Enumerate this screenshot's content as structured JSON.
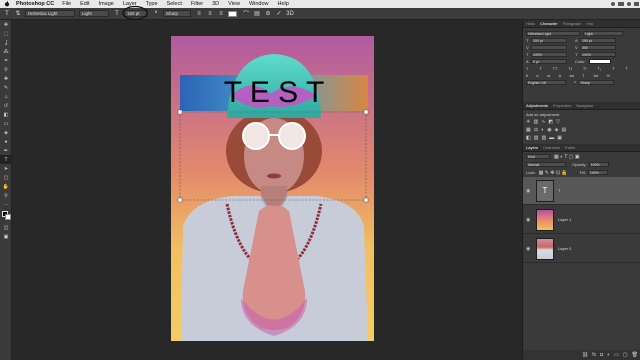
{
  "menubar": {
    "app_name": "Photoshop CC",
    "items": [
      "File",
      "Edit",
      "Image",
      "Layer",
      "Type",
      "Select",
      "Filter",
      "3D",
      "View",
      "Window",
      "Help"
    ]
  },
  "options": {
    "font_family": "Helvetica Light",
    "font_style": "Light",
    "font_size": "150 pt",
    "antialias": "Sharp"
  },
  "canvas": {
    "text_layer": "T E S T"
  },
  "panels": {
    "top_tabs": [
      "Histo",
      "Character",
      "Paragraph",
      "Info"
    ],
    "character": {
      "font_family": "Helvetica Light",
      "font_style": "Light",
      "size": "150 pt",
      "leading": "150 pt",
      "tracking": "350",
      "vertical_scale": "100%",
      "horizontal_scale": "100%",
      "baseline": "0 pt",
      "color_label": "Color:",
      "language": "English: UK",
      "antialias": "Sharp"
    },
    "adjustments_tabs": [
      "Adjustments",
      "Properties",
      "Navigator"
    ],
    "adjustments_hint": "Add an adjustment",
    "layers_tabs": [
      "Layers",
      "Channels",
      "Paths"
    ],
    "layers_filter": "Kind",
    "blend_mode": "Normal",
    "opacity_label": "Opacity:",
    "opacity": "100%",
    "lock_label": "Lock:",
    "fill_label": "Fill:",
    "fill": "100%",
    "layers": [
      {
        "name": "T",
        "type": "text"
      },
      {
        "name": "Layer 1",
        "type": "gradient"
      },
      {
        "name": "Layer 0",
        "type": "photo"
      }
    ]
  },
  "colors": {
    "accent": "#3d7ddb",
    "panel_bg": "#3a3a3a",
    "workspace_bg": "#282828"
  }
}
